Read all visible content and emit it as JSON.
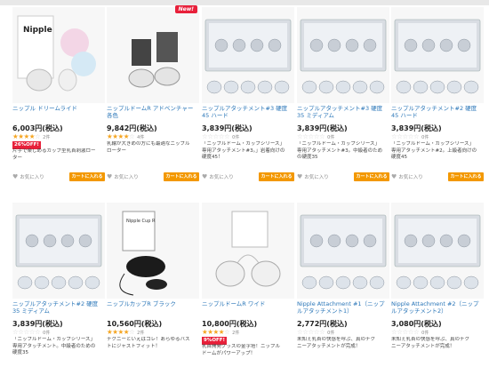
{
  "colors": {
    "link": "#2a76b8",
    "cart": "#f39800",
    "badge": "#e8203a",
    "star": "#f5a623"
  },
  "labels": {
    "favorite": "お気に入り",
    "add_to_cart": "カートに入れる"
  },
  "new_label": "New!",
  "products": [
    {
      "name": "ニップル ドリームライド",
      "price": "6,003円(税込)",
      "stars": 4,
      "count": "2件",
      "off": "26%OFF!",
      "desc": "片手で楽しめるカップ型乳首刺激ロー\nター",
      "is_new": false
    },
    {
      "name": "ニップルドームR アドベンチャー 各色",
      "price": "9,842円(税込)",
      "stars": 4,
      "count": "4件",
      "off": "",
      "desc": "乳輪が大きめの方にも最適なニップル\nローター",
      "is_new": true
    },
    {
      "name": "ニップルアタッチメント#3 硬度 45 ハード",
      "price": "3,839円(税込)",
      "stars": 0,
      "count": "0件",
      "off": "",
      "desc": "「ニップルドーム・カップシリーズ」\n専用アタッチメント#3。」岩着向けの\n硬度45！",
      "is_new": false
    },
    {
      "name": "ニップルアタッチメント#3 硬度 35 ミディアム",
      "price": "3,839円(税込)",
      "stars": 0,
      "count": "0件",
      "off": "",
      "desc": "「ニップルドーム・カップシリーズ」\n専用アタッチメント#3。中級者のため\nの硬度35",
      "is_new": false
    },
    {
      "name": "ニップルアタッチメント#2 硬度 45 ハード",
      "price": "3,839円(税込)",
      "stars": 0,
      "count": "0件",
      "off": "",
      "desc": "「ニップルドーム・カップシリーズ」\n専用アタッチメント#2。上級者向けの\n硬度45",
      "is_new": false
    },
    {
      "name": "ニップルアタッチメント#2 硬度 35 ミディアム",
      "price": "3,839円(税込)",
      "stars": 0,
      "count": "0件",
      "off": "",
      "desc": "「ニップルドーム・カップシリーズ」\n専用アタッチメント。中級者のための\n硬度35",
      "is_new": false
    },
    {
      "name": "ニップルカップR ブラック",
      "price": "10,560円(税込)",
      "stars": 4,
      "count": "2件",
      "off": "",
      "desc": "チクニーといえばコレ！あらゆるバス\nトにジャストフィット！",
      "is_new": false
    },
    {
      "name": "ニップルドームR ワイド",
      "price": "10,800円(税込)",
      "stars": 4,
      "count": "2件",
      "off": "9%OFF!",
      "desc": "乳首開発グッズの金字塔！ニップル\nドームがパワーアップ！",
      "is_new": false
    },
    {
      "name": "Nipple Attachment #1（ニップルアタッチメント1）",
      "price": "2,772円(税込)",
      "stars": 0,
      "count": "0件",
      "off": "",
      "desc": "未知ぇ乳首の快感を呼ぶ、真のチク\nニーアタッチメントが完成！",
      "is_new": false
    },
    {
      "name": "Nipple Attachment #2（ニップルアタッチメント2）",
      "price": "3,080円(税込)",
      "stars": 0,
      "count": "0件",
      "off": "",
      "desc": "未知ぇ乳首の快感を呼ぶ、真のチク\nニーアタッチメントが完成！",
      "is_new": false
    }
  ]
}
